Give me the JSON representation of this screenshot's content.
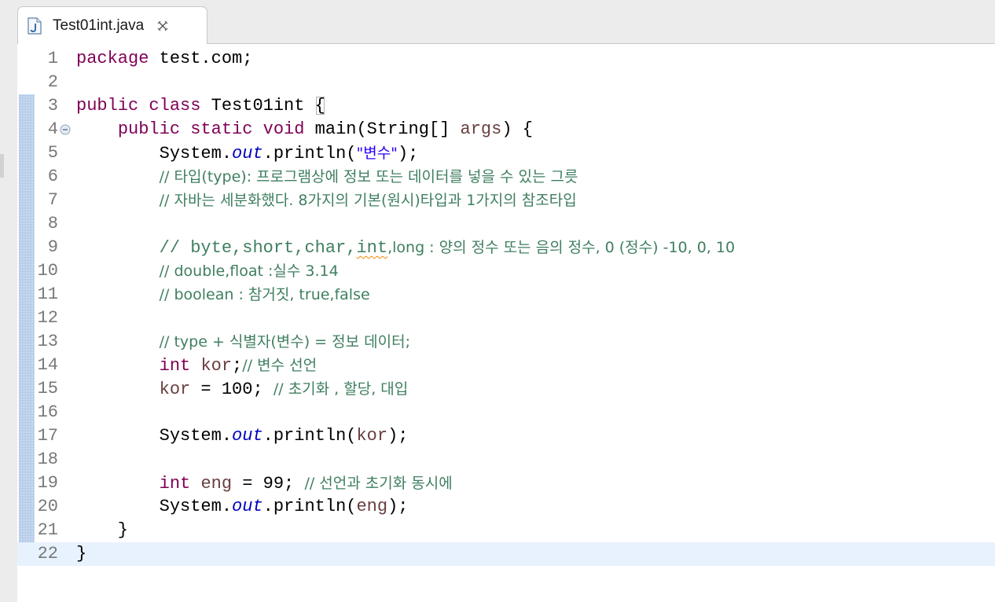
{
  "tab": {
    "filename": "Test01int.java",
    "file_icon": "java-file-icon",
    "close_icon": "close-icon"
  },
  "colors": {
    "keyword": "#7f0055",
    "string": "#2a00ff",
    "comment": "#3f7f5f",
    "field": "#0000c0",
    "variable": "#6a3e3e",
    "line_number": "#787878",
    "current_line": "#e8f2fe"
  },
  "editor": {
    "current_line": 22,
    "lines": [
      {
        "n": "1",
        "tokens": [
          {
            "t": "kw",
            "v": "package"
          },
          {
            "t": "plain",
            "v": " test.com;"
          }
        ]
      },
      {
        "n": "2",
        "tokens": []
      },
      {
        "n": "3",
        "tokens": [
          {
            "t": "kw",
            "v": "public"
          },
          {
            "t": "plain",
            "v": " "
          },
          {
            "t": "kw",
            "v": "class"
          },
          {
            "t": "plain",
            "v": " Test01int "
          },
          {
            "t": "bracket",
            "v": "{"
          }
        ]
      },
      {
        "n": "4",
        "fold": true,
        "tokens": [
          {
            "t": "plain",
            "v": "    "
          },
          {
            "t": "kw",
            "v": "public"
          },
          {
            "t": "plain",
            "v": " "
          },
          {
            "t": "kw",
            "v": "static"
          },
          {
            "t": "plain",
            "v": " "
          },
          {
            "t": "kw",
            "v": "void"
          },
          {
            "t": "plain",
            "v": " main(String[] "
          },
          {
            "t": "var",
            "v": "args"
          },
          {
            "t": "plain",
            "v": ") {"
          }
        ]
      },
      {
        "n": "5",
        "tokens": [
          {
            "t": "plain",
            "v": "        System."
          },
          {
            "t": "fld",
            "v": "out"
          },
          {
            "t": "plain",
            "v": ".println("
          },
          {
            "t": "str",
            "v": "\"변수\""
          },
          {
            "t": "plain",
            "v": ");"
          }
        ]
      },
      {
        "n": "6",
        "tokens": [
          {
            "t": "plain",
            "v": "        "
          },
          {
            "t": "cm",
            "v": "// 타입(type): 프로그램상에 정보 또는 데이터를 넣을 수 있는 그릇"
          }
        ]
      },
      {
        "n": "7",
        "tokens": [
          {
            "t": "plain",
            "v": "        "
          },
          {
            "t": "cm",
            "v": "// 자바는 세분화했다. 8가지의 기본(원시)타입과 1가지의 참조타입"
          }
        ]
      },
      {
        "n": "8",
        "tokens": []
      },
      {
        "n": "9",
        "tokens": [
          {
            "t": "plain",
            "v": "        "
          },
          {
            "t": "cm",
            "v": "// byte,short,char,"
          },
          {
            "t": "cmsq",
            "v": "int"
          },
          {
            "t": "cm",
            "v": ",long : 양의 정수 또는 음의 정수, 0 (정수) -10, 0, 10"
          }
        ]
      },
      {
        "n": "10",
        "tokens": [
          {
            "t": "plain",
            "v": "        "
          },
          {
            "t": "cm",
            "v": "// double,float :실수 3.14"
          }
        ]
      },
      {
        "n": "11",
        "tokens": [
          {
            "t": "plain",
            "v": "        "
          },
          {
            "t": "cm",
            "v": "// boolean : 참거짓, true,false"
          }
        ]
      },
      {
        "n": "12",
        "tokens": []
      },
      {
        "n": "13",
        "tokens": [
          {
            "t": "plain",
            "v": "        "
          },
          {
            "t": "cm",
            "v": "// type + 식별자(변수) = 정보 데이터;"
          }
        ]
      },
      {
        "n": "14",
        "tokens": [
          {
            "t": "plain",
            "v": "        "
          },
          {
            "t": "kw",
            "v": "int"
          },
          {
            "t": "plain",
            "v": " "
          },
          {
            "t": "var",
            "v": "kor"
          },
          {
            "t": "plain",
            "v": ";"
          },
          {
            "t": "cm",
            "v": "// 변수 선언"
          }
        ]
      },
      {
        "n": "15",
        "tokens": [
          {
            "t": "plain",
            "v": "        "
          },
          {
            "t": "var",
            "v": "kor"
          },
          {
            "t": "plain",
            "v": " = 100; "
          },
          {
            "t": "cm",
            "v": "// 초기화 , 할당, 대입"
          }
        ]
      },
      {
        "n": "16",
        "tokens": []
      },
      {
        "n": "17",
        "tokens": [
          {
            "t": "plain",
            "v": "        System."
          },
          {
            "t": "fld",
            "v": "out"
          },
          {
            "t": "plain",
            "v": ".println("
          },
          {
            "t": "var",
            "v": "kor"
          },
          {
            "t": "plain",
            "v": ");"
          }
        ]
      },
      {
        "n": "18",
        "tokens": []
      },
      {
        "n": "19",
        "tokens": [
          {
            "t": "plain",
            "v": "        "
          },
          {
            "t": "kw",
            "v": "int"
          },
          {
            "t": "plain",
            "v": " "
          },
          {
            "t": "var",
            "v": "eng"
          },
          {
            "t": "plain",
            "v": " = 99; "
          },
          {
            "t": "cm",
            "v": "// 선언과 초기화 동시에"
          }
        ]
      },
      {
        "n": "20",
        "tokens": [
          {
            "t": "plain",
            "v": "        System."
          },
          {
            "t": "fld",
            "v": "out"
          },
          {
            "t": "plain",
            "v": ".println("
          },
          {
            "t": "var",
            "v": "eng"
          },
          {
            "t": "plain",
            "v": ");"
          }
        ]
      },
      {
        "n": "21",
        "tokens": [
          {
            "t": "plain",
            "v": "    }"
          }
        ]
      },
      {
        "n": "22",
        "tokens": [
          {
            "t": "plain",
            "v": "}"
          }
        ]
      }
    ]
  }
}
